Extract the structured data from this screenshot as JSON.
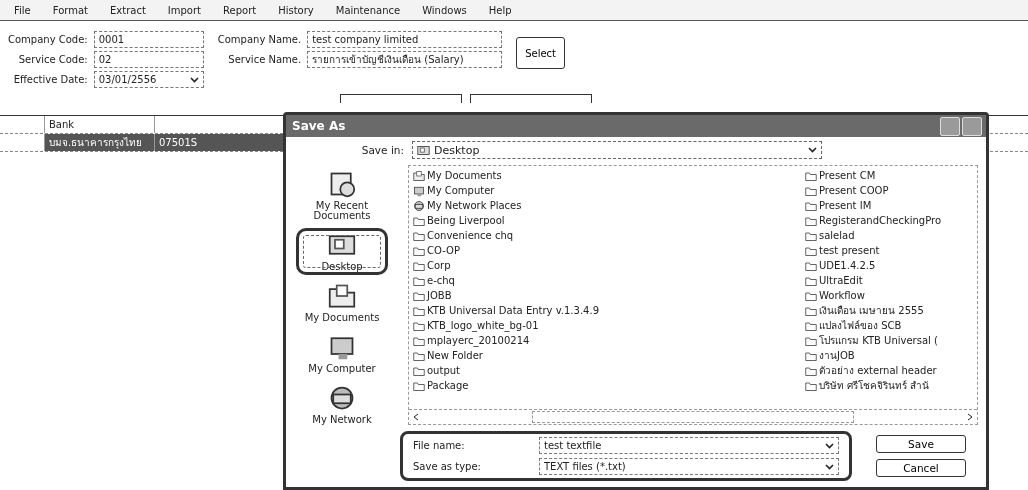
{
  "menu": [
    "File",
    "Format",
    "Extract",
    "Import",
    "Report",
    "History",
    "Maintenance",
    "Windows",
    "Help"
  ],
  "form": {
    "company_code_label": "Company Code:",
    "company_code": "0001",
    "service_code_label": "Service Code:",
    "service_code": "02",
    "effective_date_label": "Effective Date:",
    "effective_date": "03/01/2556",
    "company_name_label": "Company Name.",
    "company_name": "test company limited",
    "service_name_label": "Service Name.",
    "service_name": "รายการเข้าบัญชีเงินเดือน (Salary)",
    "select_button": "Select"
  },
  "grid": {
    "columns": [
      "",
      "Bank",
      ""
    ],
    "rows": [
      {
        "cells": [
          "",
          "บมจ.ธนาคารกรุงไทย",
          "07501S"
        ],
        "selected": true
      }
    ]
  },
  "dialog": {
    "title": "Save As",
    "save_in_label": "Save in:",
    "save_in": "Desktop",
    "places": [
      {
        "label": "My Recent Documents",
        "kind": "recent",
        "selected": false,
        "highlighted": false
      },
      {
        "label": "Desktop",
        "kind": "desktop",
        "selected": true,
        "highlighted": true
      },
      {
        "label": "My Documents",
        "kind": "documents",
        "selected": false,
        "highlighted": false
      },
      {
        "label": "My Computer",
        "kind": "computer",
        "selected": false,
        "highlighted": false
      },
      {
        "label": "My Network",
        "kind": "network",
        "selected": false,
        "highlighted": false
      }
    ],
    "files": [
      {
        "name": "My Documents",
        "kind": "documents"
      },
      {
        "name": "My Computer",
        "kind": "computer"
      },
      {
        "name": "My Network Places",
        "kind": "network"
      },
      {
        "name": "Being Liverpool",
        "kind": "folder"
      },
      {
        "name": "Convenience chq",
        "kind": "folder"
      },
      {
        "name": "CO-OP",
        "kind": "folder"
      },
      {
        "name": "Corp",
        "kind": "folder"
      },
      {
        "name": "e-chq",
        "kind": "folder"
      },
      {
        "name": "JOBB",
        "kind": "folder"
      },
      {
        "name": "KTB Universal Data Entry v.1.3.4.9",
        "kind": "folder"
      },
      {
        "name": "KTB_logo_white_bg-01",
        "kind": "folder"
      },
      {
        "name": "mplayerc_20100214",
        "kind": "folder"
      },
      {
        "name": "New Folder",
        "kind": "folder"
      },
      {
        "name": "output",
        "kind": "folder"
      },
      {
        "name": "Package",
        "kind": "folder"
      },
      {
        "name": "Present CM",
        "kind": "folder"
      },
      {
        "name": "Present COOP",
        "kind": "folder"
      },
      {
        "name": "Present IM",
        "kind": "folder"
      },
      {
        "name": "RegisterandCheckingPro",
        "kind": "folder"
      },
      {
        "name": "salelad",
        "kind": "folder"
      },
      {
        "name": "test present",
        "kind": "folder"
      },
      {
        "name": "UDE1.4.2.5",
        "kind": "folder"
      },
      {
        "name": "UltraEdit",
        "kind": "folder"
      },
      {
        "name": "Workflow",
        "kind": "folder"
      },
      {
        "name": "เงินเดือน เมษายน 2555",
        "kind": "folder"
      },
      {
        "name": "แปลงไฟล์ของ SCB",
        "kind": "folder"
      },
      {
        "name": "โปรแกรม KTB Universal (",
        "kind": "folder"
      },
      {
        "name": "งานJOB",
        "kind": "folder"
      },
      {
        "name": "ตัวอย่าง external header",
        "kind": "folder"
      },
      {
        "name": "บริษัท ศรีโชคจิรินทร์ สำนั",
        "kind": "folder"
      }
    ],
    "file_name_label": "File name:",
    "file_name": "test textfile",
    "save_as_type_label": "Save as type:",
    "save_as_type": "TEXT files (*.txt)",
    "fields_highlighted": true,
    "buttons": [
      "Save",
      "Cancel"
    ]
  }
}
